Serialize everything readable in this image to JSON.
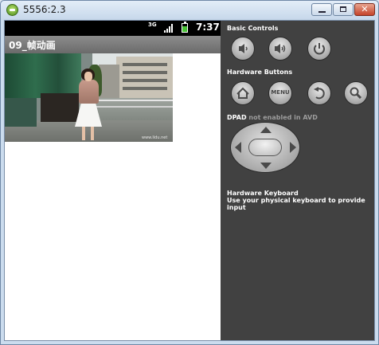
{
  "window": {
    "title": "5556:2.3",
    "minimize_label": "",
    "maximize_label": "",
    "close_label": "✕"
  },
  "status_bar": {
    "network_label": "3G",
    "time": "7:37"
  },
  "app": {
    "title": "09_帧动画",
    "image_watermark": "www.lidu.net"
  },
  "controls": {
    "basic_controls_label": "Basic Controls",
    "basic_buttons": [
      "volume-down",
      "volume-up",
      "power"
    ],
    "hardware_buttons_label": "Hardware Buttons",
    "menu_label": "MENU",
    "dpad_label": "DPAD",
    "dpad_note": "not enabled in AVD",
    "keyboard_title": "Hardware Keyboard",
    "keyboard_note": "Use your physical keyboard to provide input"
  },
  "colors": {
    "panel_bg": "#414141",
    "status_bar_bg": "#000000",
    "app_bar_bg": "#7a7a7a",
    "battery": "#49c236"
  }
}
